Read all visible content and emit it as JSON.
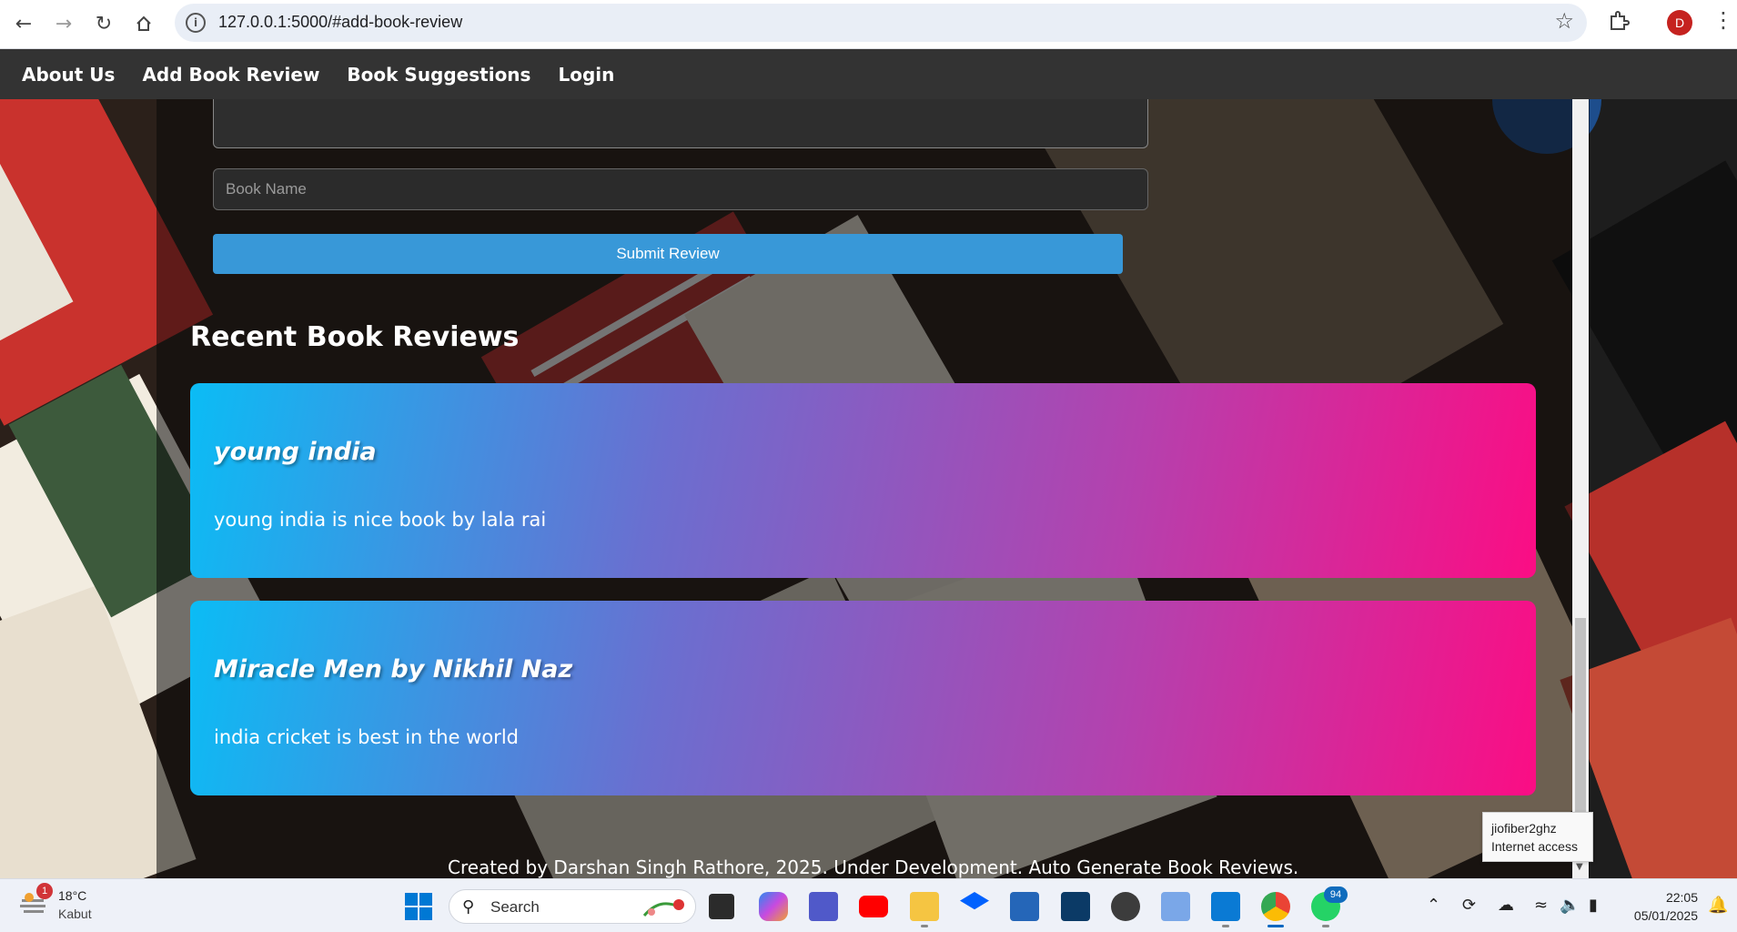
{
  "browser": {
    "url": "127.0.0.1:5000/#add-book-review",
    "profile_initial": "D"
  },
  "nav": {
    "items": [
      "About Us",
      "Add Book Review",
      "Book Suggestions",
      "Login"
    ]
  },
  "form": {
    "book_name_placeholder": "Book Name",
    "submit_label": "Submit Review"
  },
  "recent": {
    "title": "Recent Book Reviews",
    "reviews": [
      {
        "title": "young india",
        "text": "young india is nice book by lala rai"
      },
      {
        "title": "Miracle Men by Nikhil Naz",
        "text": "india cricket is best in the world"
      }
    ]
  },
  "footer": {
    "text": "Created by Darshan Singh Rathore, 2025. Under Development. Auto Generate Book Reviews."
  },
  "tooltip": {
    "line1": "jiofiber2ghz",
    "line2": "Internet access"
  },
  "taskbar": {
    "weather_badge": "1",
    "temperature": "18°C",
    "condition": "Kabut",
    "search_label": "Search",
    "whatsapp_badge": "94",
    "time": "22:05",
    "date": "05/01/2025"
  },
  "colors": {
    "nav_bg": "#333333",
    "submit_bg": "#3898d8",
    "card_gradient_start": "#0bbcf5",
    "card_gradient_end": "#fb0d84"
  }
}
